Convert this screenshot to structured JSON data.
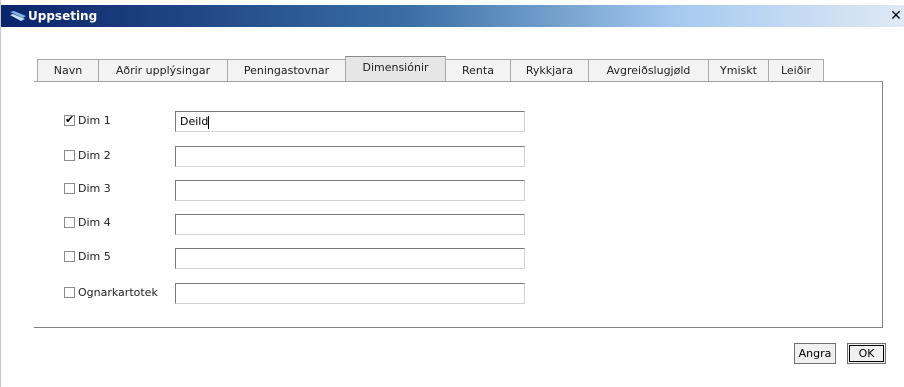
{
  "window": {
    "title": "Uppseting",
    "close_glyph": "✕"
  },
  "tabs": [
    {
      "label": "Navn",
      "active": false
    },
    {
      "label": "Aðrir upplýsingar",
      "active": false
    },
    {
      "label": "Peningastovnar",
      "active": false
    },
    {
      "label": "Dimensiónir",
      "active": true
    },
    {
      "label": "Renta",
      "active": false
    },
    {
      "label": "Rykkjara",
      "active": false
    },
    {
      "label": "Avgreiðslugjøld",
      "active": false
    },
    {
      "label": "Ymiskt",
      "active": false
    },
    {
      "label": "Leiðir",
      "active": false
    }
  ],
  "dimensions": [
    {
      "label": "Dim 1",
      "checked": true,
      "value": "Deild"
    },
    {
      "label": "Dim 2",
      "checked": false,
      "value": ""
    },
    {
      "label": "Dim 3",
      "checked": false,
      "value": ""
    },
    {
      "label": "Dim 4",
      "checked": false,
      "value": ""
    },
    {
      "label": "Dim 5",
      "checked": false,
      "value": ""
    },
    {
      "label": "Ognarkartotek",
      "checked": false,
      "value": ""
    }
  ],
  "buttons": {
    "cancel": "Angra",
    "ok": "OK"
  },
  "icons": {
    "title_icon": "app-window-icon",
    "check_mark": "✔"
  },
  "colors": {
    "titlebar_start": "#0a246a",
    "titlebar_end": "#dfe9f5"
  }
}
